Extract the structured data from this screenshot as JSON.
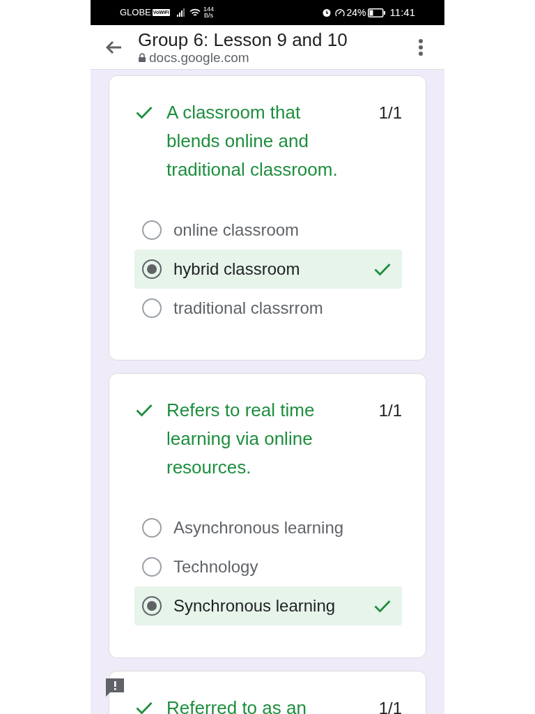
{
  "status_bar": {
    "carrier": "GLOBE",
    "wifi_calling": "VoWiFi",
    "speed": "144",
    "speed_unit": "B/s",
    "battery": "24%",
    "time": "11:41"
  },
  "header": {
    "title": "Group 6: Lesson 9 and 10",
    "url": "docs.google.com"
  },
  "questions": [
    {
      "title": "A classroom that blends online and traditional classroom.",
      "score": "1/1",
      "correct": true,
      "options": [
        {
          "label": "online classroom",
          "selected": false,
          "correct": false
        },
        {
          "label": "hybrid classroom",
          "selected": true,
          "correct": true
        },
        {
          "label": "traditional classrrom",
          "selected": false,
          "correct": false
        }
      ]
    },
    {
      "title": "Refers to real time learning via online resources.",
      "score": "1/1",
      "correct": true,
      "options": [
        {
          "label": "Asynchronous learning",
          "selected": false,
          "correct": false
        },
        {
          "label": "Technology",
          "selected": false,
          "correct": false
        },
        {
          "label": "Synchronous learning",
          "selected": true,
          "correct": true
        }
      ]
    },
    {
      "title": "Referred to as an",
      "score": "1/1",
      "correct": true,
      "feedback_badge": true
    }
  ]
}
